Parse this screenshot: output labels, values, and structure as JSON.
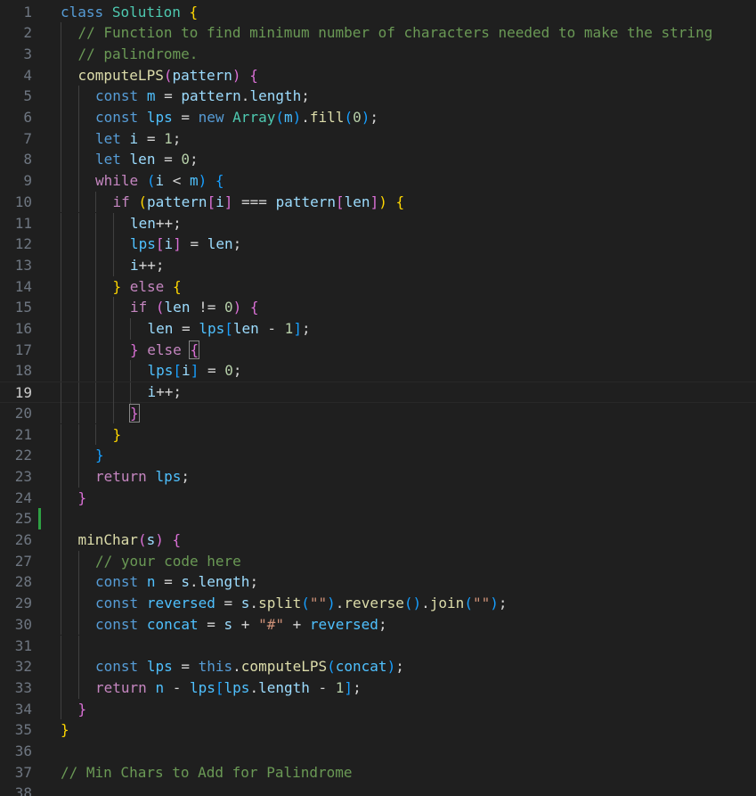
{
  "editor": {
    "language": "javascript",
    "current_line": 19,
    "modified_lines": [
      25
    ],
    "colors": {
      "background": "#1f1f1f",
      "line_number": "#6e7681",
      "keyword": "#569cd6",
      "control": "#c586c0",
      "class_name": "#4ec9b0",
      "function": "#dcdcaa",
      "variable": "#9cdcfe",
      "constant": "#4fc1ff",
      "number": "#b5cea8",
      "string": "#ce9178",
      "comment": "#6a9955",
      "bracket_1": "#ffd700",
      "bracket_2": "#da70d6",
      "bracket_3": "#179fff",
      "modified_gutter": "#2ea043"
    },
    "lines": [
      {
        "n": "1",
        "t": [
          [
            "class",
            "kw"
          ],
          [
            " "
          ],
          [
            "Solution",
            "cls"
          ],
          [
            " "
          ],
          [
            "{",
            "b1"
          ]
        ]
      },
      {
        "n": "2",
        "t": [
          [
            "// Function to find minimum number of characters needed to make the string",
            "cmt"
          ]
        ]
      },
      {
        "n": "3",
        "t": [
          [
            "// palindrome.",
            "cmt"
          ]
        ]
      },
      {
        "n": "4",
        "t": [
          [
            "computeLPS",
            "fn"
          ],
          [
            "(",
            "b2"
          ],
          [
            "pattern",
            "var"
          ],
          [
            ")",
            "b2"
          ],
          [
            " "
          ],
          [
            "{",
            "b2"
          ]
        ]
      },
      {
        "n": "5",
        "t": [
          [
            "const",
            "kw"
          ],
          [
            " "
          ],
          [
            "m",
            "cst"
          ],
          [
            " = "
          ],
          [
            "pattern",
            "var"
          ],
          [
            "."
          ],
          [
            "length",
            "var"
          ],
          [
            ";"
          ]
        ]
      },
      {
        "n": "6",
        "t": [
          [
            "const",
            "kw"
          ],
          [
            " "
          ],
          [
            "lps",
            "cst"
          ],
          [
            " = "
          ],
          [
            "new",
            "kw"
          ],
          [
            " "
          ],
          [
            "Array",
            "cls"
          ],
          [
            "(",
            "b3"
          ],
          [
            "m",
            "cst"
          ],
          [
            ")",
            "b3"
          ],
          [
            "."
          ],
          [
            "fill",
            "fn"
          ],
          [
            "(",
            "b3"
          ],
          [
            "0",
            "num"
          ],
          [
            ")",
            "b3"
          ],
          [
            ";"
          ]
        ]
      },
      {
        "n": "7",
        "t": [
          [
            "let",
            "kw"
          ],
          [
            " "
          ],
          [
            "i",
            "var"
          ],
          [
            " = "
          ],
          [
            "1",
            "num"
          ],
          [
            ";"
          ]
        ]
      },
      {
        "n": "8",
        "t": [
          [
            "let",
            "kw"
          ],
          [
            " "
          ],
          [
            "len",
            "var"
          ],
          [
            " = "
          ],
          [
            "0",
            "num"
          ],
          [
            ";"
          ]
        ]
      },
      {
        "n": "9",
        "t": [
          [
            "while",
            "ctl"
          ],
          [
            " "
          ],
          [
            "(",
            "b3"
          ],
          [
            "i",
            "var"
          ],
          [
            " < "
          ],
          [
            "m",
            "cst"
          ],
          [
            ")",
            "b3"
          ],
          [
            " "
          ],
          [
            "{",
            "b3"
          ]
        ]
      },
      {
        "n": "10",
        "t": [
          [
            "if",
            "ctl"
          ],
          [
            " "
          ],
          [
            "(",
            "b1"
          ],
          [
            "pattern",
            "var"
          ],
          [
            "[",
            "b2"
          ],
          [
            "i",
            "var"
          ],
          [
            "]",
            "b2"
          ],
          [
            " === "
          ],
          [
            "pattern",
            "var"
          ],
          [
            "[",
            "b2"
          ],
          [
            "len",
            "var"
          ],
          [
            "]",
            "b2"
          ],
          [
            ")",
            "b1"
          ],
          [
            " "
          ],
          [
            "{",
            "b1"
          ]
        ]
      },
      {
        "n": "11",
        "t": [
          [
            "len",
            "var"
          ],
          [
            "++;"
          ]
        ]
      },
      {
        "n": "12",
        "t": [
          [
            "lps",
            "cst"
          ],
          [
            "[",
            "b2"
          ],
          [
            "i",
            "var"
          ],
          [
            "]",
            "b2"
          ],
          [
            " = "
          ],
          [
            "len",
            "var"
          ],
          [
            ";"
          ]
        ]
      },
      {
        "n": "13",
        "t": [
          [
            "i",
            "var"
          ],
          [
            "++;"
          ]
        ]
      },
      {
        "n": "14",
        "t": [
          [
            "}",
            "b1"
          ],
          [
            " "
          ],
          [
            "else",
            "ctl"
          ],
          [
            " "
          ],
          [
            "{",
            "b1"
          ]
        ]
      },
      {
        "n": "15",
        "t": [
          [
            "if",
            "ctl"
          ],
          [
            " "
          ],
          [
            "(",
            "b2"
          ],
          [
            "len",
            "var"
          ],
          [
            " != "
          ],
          [
            "0",
            "num"
          ],
          [
            ")",
            "b2"
          ],
          [
            " "
          ],
          [
            "{",
            "b2"
          ]
        ]
      },
      {
        "n": "16",
        "t": [
          [
            "len",
            "var"
          ],
          [
            " = "
          ],
          [
            "lps",
            "cst"
          ],
          [
            "[",
            "b3"
          ],
          [
            "len",
            "var"
          ],
          [
            " - "
          ],
          [
            "1",
            "num"
          ],
          [
            "]",
            "b3"
          ],
          [
            ";"
          ]
        ]
      },
      {
        "n": "17",
        "t": [
          [
            "}",
            "b2"
          ],
          [
            " "
          ],
          [
            "else",
            "ctl"
          ],
          [
            " "
          ],
          [
            "{",
            "b2 bm"
          ]
        ]
      },
      {
        "n": "18",
        "t": [
          [
            "lps",
            "cst"
          ],
          [
            "[",
            "b3"
          ],
          [
            "i",
            "var"
          ],
          [
            "]",
            "b3"
          ],
          [
            " = "
          ],
          [
            "0",
            "num"
          ],
          [
            ";"
          ]
        ]
      },
      {
        "n": "19",
        "t": [
          [
            "i",
            "var"
          ],
          [
            "++;"
          ]
        ]
      },
      {
        "n": "20",
        "t": [
          [
            "}",
            "b2 bm"
          ]
        ]
      },
      {
        "n": "21",
        "t": [
          [
            "}",
            "b1"
          ]
        ]
      },
      {
        "n": "22",
        "t": [
          [
            "}",
            "b3"
          ]
        ]
      },
      {
        "n": "23",
        "t": [
          [
            "return",
            "ctl"
          ],
          [
            " "
          ],
          [
            "lps",
            "cst"
          ],
          [
            ";"
          ]
        ]
      },
      {
        "n": "24",
        "t": [
          [
            "}",
            "b2"
          ]
        ]
      },
      {
        "n": "25",
        "t": []
      },
      {
        "n": "26",
        "t": [
          [
            "minChar",
            "fn"
          ],
          [
            "(",
            "b2"
          ],
          [
            "s",
            "var"
          ],
          [
            ")",
            "b2"
          ],
          [
            " "
          ],
          [
            "{",
            "b2"
          ]
        ]
      },
      {
        "n": "27",
        "t": [
          [
            "// your code here",
            "cmt"
          ]
        ]
      },
      {
        "n": "28",
        "t": [
          [
            "const",
            "kw"
          ],
          [
            " "
          ],
          [
            "n",
            "cst"
          ],
          [
            " = "
          ],
          [
            "s",
            "var"
          ],
          [
            "."
          ],
          [
            "length",
            "var"
          ],
          [
            ";"
          ]
        ]
      },
      {
        "n": "29",
        "t": [
          [
            "const",
            "kw"
          ],
          [
            " "
          ],
          [
            "reversed",
            "cst"
          ],
          [
            " = "
          ],
          [
            "s",
            "var"
          ],
          [
            "."
          ],
          [
            "split",
            "fn"
          ],
          [
            "(",
            "b3"
          ],
          [
            "\"\"",
            "str"
          ],
          [
            ")",
            "b3"
          ],
          [
            "."
          ],
          [
            "reverse",
            "fn"
          ],
          [
            "(",
            "b3"
          ],
          [
            ")",
            "b3"
          ],
          [
            "."
          ],
          [
            "join",
            "fn"
          ],
          [
            "(",
            "b3"
          ],
          [
            "\"\"",
            "str"
          ],
          [
            ")",
            "b3"
          ],
          [
            ";"
          ]
        ]
      },
      {
        "n": "30",
        "t": [
          [
            "const",
            "kw"
          ],
          [
            " "
          ],
          [
            "concat",
            "cst"
          ],
          [
            " = "
          ],
          [
            "s",
            "var"
          ],
          [
            " + "
          ],
          [
            "\"#\"",
            "str"
          ],
          [
            " + "
          ],
          [
            "reversed",
            "cst"
          ],
          [
            ";"
          ]
        ]
      },
      {
        "n": "31",
        "t": []
      },
      {
        "n": "32",
        "t": [
          [
            "const",
            "kw"
          ],
          [
            " "
          ],
          [
            "lps",
            "cst"
          ],
          [
            " = "
          ],
          [
            "this",
            "kw"
          ],
          [
            "."
          ],
          [
            "computeLPS",
            "fn"
          ],
          [
            "(",
            "b3"
          ],
          [
            "concat",
            "cst"
          ],
          [
            ")",
            "b3"
          ],
          [
            ";"
          ]
        ]
      },
      {
        "n": "33",
        "t": [
          [
            "return",
            "ctl"
          ],
          [
            " "
          ],
          [
            "n",
            "cst"
          ],
          [
            " - "
          ],
          [
            "lps",
            "cst"
          ],
          [
            "[",
            "b3"
          ],
          [
            "lps",
            "cst"
          ],
          [
            "."
          ],
          [
            "length",
            "var"
          ],
          [
            " - "
          ],
          [
            "1",
            "num"
          ],
          [
            "]",
            "b3"
          ],
          [
            ";"
          ]
        ]
      },
      {
        "n": "34",
        "t": [
          [
            "}",
            "b2"
          ]
        ]
      },
      {
        "n": "35",
        "t": [
          [
            "}",
            "b1"
          ]
        ]
      },
      {
        "n": "36",
        "t": []
      },
      {
        "n": "37",
        "t": [
          [
            "// Min Chars to Add for Palindrome",
            "cmt"
          ]
        ]
      },
      {
        "n": "38",
        "t": []
      }
    ]
  }
}
